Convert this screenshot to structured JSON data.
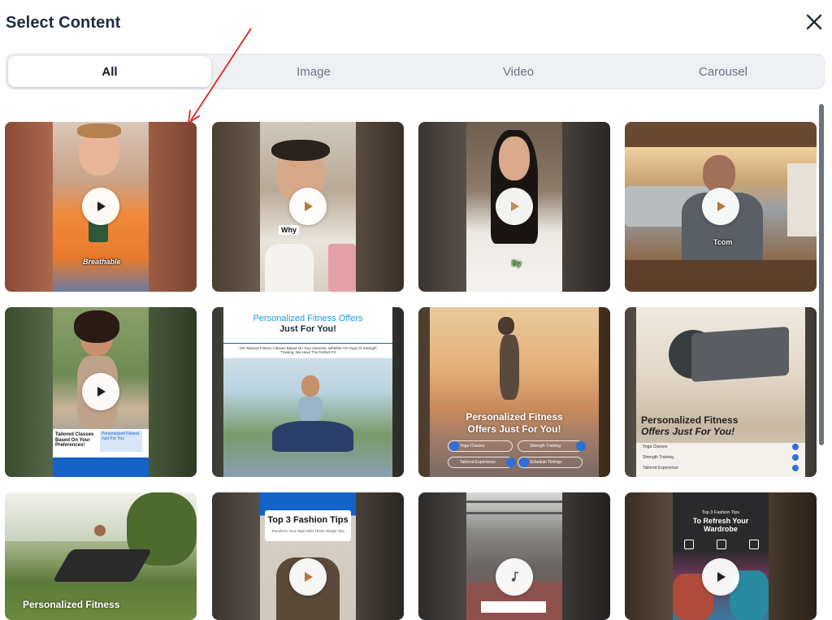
{
  "dialog": {
    "title": "Select Content"
  },
  "tabs": [
    {
      "label": "All"
    },
    {
      "label": "Image"
    },
    {
      "label": "Video"
    },
    {
      "label": "Carousel"
    }
  ],
  "active_tab": "All",
  "cards": [
    {
      "kind": "video",
      "caption": "Breathable"
    },
    {
      "kind": "video",
      "caption": "Why"
    },
    {
      "kind": "video",
      "caption": "By"
    },
    {
      "kind": "video",
      "caption": "Tcom"
    },
    {
      "kind": "video",
      "caption_left": "Tailored Classes Based On Your Preferences!",
      "caption_right": "Personalized Fitness Just For You"
    },
    {
      "kind": "image",
      "headline": "Personalized Fitness Offers",
      "headline2": "Just For You!",
      "subtext": "Get Tailored Fitness Classes Based On Your Interests, Whether It's Yoga Or Strength Training. We Have The Perfect Fit"
    },
    {
      "kind": "image",
      "headline": "Personalized Fitness",
      "headline2": "Offers Just For You!",
      "pills": [
        "Yoga Classes",
        "Strength Training",
        "Tailored Experience",
        "Schedule Timings"
      ]
    },
    {
      "kind": "image",
      "headline": "Personalized Fitness",
      "headline2": "Offers Just For You!",
      "rows": [
        "Yoga Classes",
        "Strength Training",
        "Tailored Experience"
      ]
    },
    {
      "kind": "image",
      "headline": "Personalized Fitness"
    },
    {
      "kind": "video",
      "headline": "Top 3 Fashion Tips",
      "subtext": "Transform Your Style With These Simple Tips"
    },
    {
      "kind": "video"
    },
    {
      "kind": "video",
      "headline_small": "Top 3 Fashion Tips",
      "headline": "To Refresh Your Wardrobe"
    }
  ],
  "colors": {
    "accent_blue": "#1463c9",
    "annotation_red": "#e0231c",
    "play_bg": "#ffffff"
  }
}
